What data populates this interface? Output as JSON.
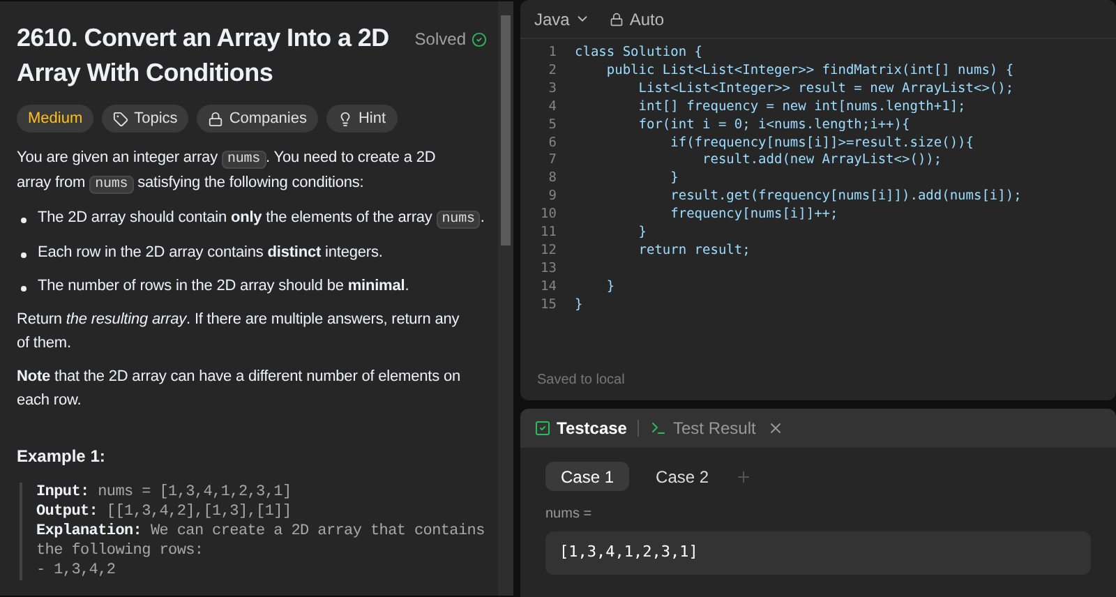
{
  "problem": {
    "title": "2610. Convert an Array Into a 2D Array With Conditions",
    "status": "Solved",
    "tags": [
      {
        "kind": "difficulty",
        "label": "Medium"
      },
      {
        "kind": "topics",
        "label": "Topics"
      },
      {
        "kind": "companies",
        "label": "Companies"
      },
      {
        "kind": "hint",
        "label": "Hint"
      }
    ],
    "paragraphs": [
      {
        "kind": "para",
        "segments": [
          {
            "kind": "text",
            "text": "You are given an integer array "
          },
          {
            "kind": "code",
            "text": "nums"
          },
          {
            "kind": "text",
            "text": ". You need to create a 2D array from "
          },
          {
            "kind": "code",
            "text": "nums"
          },
          {
            "kind": "text",
            "text": " satisfying the following conditions:"
          }
        ]
      },
      {
        "kind": "bullet",
        "segments": [
          {
            "kind": "text",
            "text": "The 2D array should contain **only** the elements of the array "
          },
          {
            "kind": "code",
            "text": "nums"
          },
          {
            "kind": "text",
            "text": "."
          }
        ]
      },
      {
        "kind": "bullet",
        "segments": [
          {
            "kind": "text",
            "text": "Each row in the 2D array contains **distinct** integers."
          }
        ]
      },
      {
        "kind": "bullet",
        "segments": [
          {
            "kind": "text",
            "text": "The number of rows in the 2D array should be **minimal**."
          }
        ]
      },
      {
        "kind": "para",
        "segments": [
          {
            "kind": "text",
            "text": "Return *the resulting array*. If there are multiple answers, return any of them."
          }
        ]
      },
      {
        "kind": "para",
        "segments": [
          {
            "kind": "text",
            "text": "**Note** that the 2D array can have a different number of elements on each row."
          }
        ]
      }
    ],
    "example_title": "Example 1:",
    "example_lines": [
      {
        "label": "Input:",
        "value": "nums = [1,3,4,1,2,3,1]"
      },
      {
        "label": "Output:",
        "value": "[[1,3,4,2],[1,3],[1]]"
      },
      {
        "label": "Explanation:",
        "value": "We can create a 2D array that contains the following rows:"
      },
      {
        "value": "- 1,3,4,2"
      }
    ]
  },
  "editor": {
    "language": "Java",
    "mode": "Auto",
    "lines": [
      {
        "number": "1",
        "code": "class Solution {"
      },
      {
        "number": "2",
        "code": "    public List<List<Integer>> findMatrix(int[] nums) {"
      },
      {
        "number": "3",
        "code": "        List<List<Integer>> result = new ArrayList<>();"
      },
      {
        "number": "4",
        "code": "        int[] frequency = new int[nums.length+1];"
      },
      {
        "number": "5",
        "code": "        for(int i = 0; i<nums.length;i++){"
      },
      {
        "number": "6",
        "code": "            if(frequency[nums[i]]>=result.size()){"
      },
      {
        "number": "7",
        "code": "                result.add(new ArrayList<>());"
      },
      {
        "number": "8",
        "code": "            }"
      },
      {
        "number": "9",
        "code": "            result.get(frequency[nums[i]]).add(nums[i]);"
      },
      {
        "number": "10",
        "code": "            frequency[nums[i]]++;"
      },
      {
        "number": "11",
        "code": "        }"
      },
      {
        "number": "12",
        "code": "        return result;"
      },
      {
        "number": "13"
      },
      {
        "number": "14",
        "code": "    }"
      },
      {
        "number": "15",
        "code": "}"
      }
    ],
    "status": "Saved to local"
  },
  "console": {
    "tabs": [
      {
        "label": "Testcase",
        "selected": true
      },
      {
        "label": "Test Result",
        "selected": false
      }
    ],
    "cases": [
      {
        "label": "Case 1",
        "selected": true
      },
      {
        "label": "Case 2",
        "selected": false
      }
    ],
    "param_label": "nums =",
    "param_value": "[1,3,4,1,2,3,1]"
  }
}
